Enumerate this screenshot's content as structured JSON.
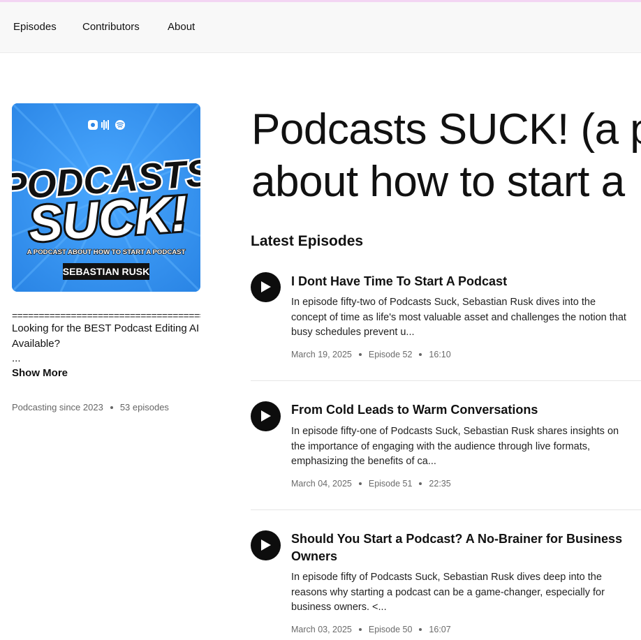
{
  "nav": {
    "items": [
      {
        "label": "Episodes"
      },
      {
        "label": "Contributors"
      },
      {
        "label": "About"
      }
    ]
  },
  "podcast": {
    "title_line1": "Podcasts SUCK! (a p",
    "title_line2": "about how to start a",
    "cover": {
      "line1": "PODCASTS",
      "line2": "SUCK!",
      "tagline": "A PODCAST ABOUT HOW TO START A PODCAST",
      "author": "SEBASTIAN RUSK",
      "bg_color": "#3a9bf5"
    },
    "description_rule": "================================================",
    "description_line1": "Looking for the BEST Podcast Editing AI",
    "description_line2": "Available?",
    "description_line3": "...",
    "show_more": "Show More",
    "since": "Podcasting since 2023",
    "episode_count": "53 episodes"
  },
  "latest": {
    "heading": "Latest Episodes",
    "episodes": [
      {
        "title": "I Dont Have Time To Start A Podcast",
        "summary": "In episode fifty-two of Podcasts Suck, Sebastian Rusk dives into the concept of time as life's most valuable asset and challenges the notion that busy schedules prevent u...",
        "date": "March 19, 2025",
        "episode": "Episode 52",
        "duration": "16:10"
      },
      {
        "title": "From Cold Leads to Warm Conversations",
        "summary": "In episode fifty-one of Podcasts Suck, Sebastian Rusk shares insights on the importance of engaging with the audience through live formats, emphasizing the benefits of ca...",
        "date": "March 04, 2025",
        "episode": "Episode 51",
        "duration": "22:35"
      },
      {
        "title": "Should You Start a Podcast? A No-Brainer for Business Owners",
        "summary": "In episode fifty of Podcasts Suck, Sebastian Rusk dives deep into the reasons why starting a podcast can be a game-changer, especially for business owners. <...",
        "date": "March 03, 2025",
        "episode": "Episode 50",
        "duration": "16:07"
      }
    ]
  }
}
